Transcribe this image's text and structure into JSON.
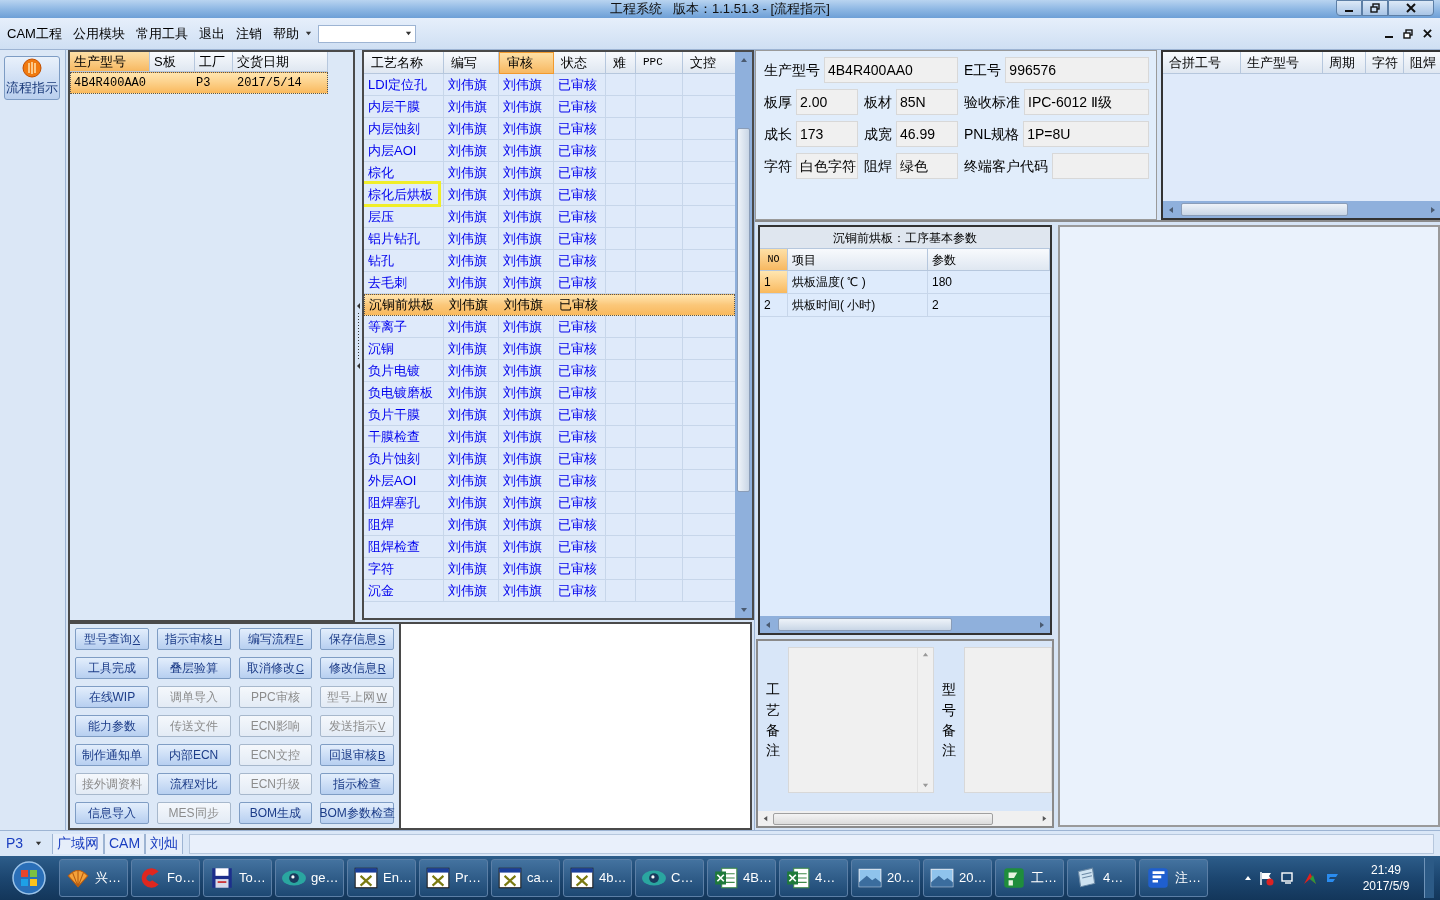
{
  "window": {
    "title": "工程系统   版本：1.1.51.3 - [流程指示]"
  },
  "menu": [
    "CAM工程",
    "公用模块",
    "常用工具",
    "退出",
    "注销",
    "帮助"
  ],
  "nav": [
    {
      "label": "流程指示",
      "selected": true
    }
  ],
  "orders": {
    "columns": [
      {
        "label": "生产型号",
        "selected": true
      },
      {
        "label": "S板",
        "selected": false
      },
      {
        "label": "工厂",
        "selected": false
      },
      {
        "label": "交货日期",
        "selected": false
      }
    ],
    "rows": [
      {
        "model": "4B4R400AA0",
        "factory": "P3",
        "date": "2017/5/14",
        "selected": true
      }
    ]
  },
  "process": {
    "columns": [
      {
        "label": "工艺名称",
        "selected": false
      },
      {
        "label": "编写",
        "selected": false
      },
      {
        "label": "审核",
        "selected": true
      },
      {
        "label": "状态",
        "selected": false
      },
      {
        "label": "难",
        "selected": false
      },
      {
        "label": "PPC",
        "selected": false
      },
      {
        "label": "文控",
        "selected": false
      }
    ],
    "rows": [
      {
        "name": "LDI定位孔",
        "writer": "刘伟旗",
        "reviewer": "刘伟旗",
        "status": "已审核",
        "selected": false,
        "outlined": false
      },
      {
        "name": "内层干膜",
        "writer": "刘伟旗",
        "reviewer": "刘伟旗",
        "status": "已审核",
        "selected": false,
        "outlined": false
      },
      {
        "name": "内层蚀刻",
        "writer": "刘伟旗",
        "reviewer": "刘伟旗",
        "status": "已审核",
        "selected": false,
        "outlined": false
      },
      {
        "name": "内层AOI",
        "writer": "刘伟旗",
        "reviewer": "刘伟旗",
        "status": "已审核",
        "selected": false,
        "outlined": false
      },
      {
        "name": "棕化",
        "writer": "刘伟旗",
        "reviewer": "刘伟旗",
        "status": "已审核",
        "selected": false,
        "outlined": false
      },
      {
        "name": "棕化后烘板",
        "writer": "刘伟旗",
        "reviewer": "刘伟旗",
        "status": "已审核",
        "selected": false,
        "outlined": true
      },
      {
        "name": "层压",
        "writer": "刘伟旗",
        "reviewer": "刘伟旗",
        "status": "已审核",
        "selected": false,
        "outlined": false
      },
      {
        "name": "铝片钻孔",
        "writer": "刘伟旗",
        "reviewer": "刘伟旗",
        "status": "已审核",
        "selected": false,
        "outlined": false
      },
      {
        "name": "钻孔",
        "writer": "刘伟旗",
        "reviewer": "刘伟旗",
        "status": "已审核",
        "selected": false,
        "outlined": false
      },
      {
        "name": "去毛刺",
        "writer": "刘伟旗",
        "reviewer": "刘伟旗",
        "status": "已审核",
        "selected": false,
        "outlined": false
      },
      {
        "name": "沉铜前烘板",
        "writer": "刘伟旗",
        "reviewer": "刘伟旗",
        "status": "已审核",
        "selected": true,
        "outlined": false
      },
      {
        "name": "等离子",
        "writer": "刘伟旗",
        "reviewer": "刘伟旗",
        "status": "已审核",
        "selected": false,
        "outlined": false
      },
      {
        "name": "沉铜",
        "writer": "刘伟旗",
        "reviewer": "刘伟旗",
        "status": "已审核",
        "selected": false,
        "outlined": false
      },
      {
        "name": "负片电镀",
        "writer": "刘伟旗",
        "reviewer": "刘伟旗",
        "status": "已审核",
        "selected": false,
        "outlined": false
      },
      {
        "name": "负电镀磨板",
        "writer": "刘伟旗",
        "reviewer": "刘伟旗",
        "status": "已审核",
        "selected": false,
        "outlined": false
      },
      {
        "name": "负片干膜",
        "writer": "刘伟旗",
        "reviewer": "刘伟旗",
        "status": "已审核",
        "selected": false,
        "outlined": false
      },
      {
        "name": "干膜检查",
        "writer": "刘伟旗",
        "reviewer": "刘伟旗",
        "status": "已审核",
        "selected": false,
        "outlined": false
      },
      {
        "name": "负片蚀刻",
        "writer": "刘伟旗",
        "reviewer": "刘伟旗",
        "status": "已审核",
        "selected": false,
        "outlined": false
      },
      {
        "name": "外层AOI",
        "writer": "刘伟旗",
        "reviewer": "刘伟旗",
        "status": "已审核",
        "selected": false,
        "outlined": false
      },
      {
        "name": "阻焊塞孔",
        "writer": "刘伟旗",
        "reviewer": "刘伟旗",
        "status": "已审核",
        "selected": false,
        "outlined": false
      },
      {
        "name": "阻焊",
        "writer": "刘伟旗",
        "reviewer": "刘伟旗",
        "status": "已审核",
        "selected": false,
        "outlined": false
      },
      {
        "name": "阻焊检查",
        "writer": "刘伟旗",
        "reviewer": "刘伟旗",
        "status": "已审核",
        "selected": false,
        "outlined": false
      },
      {
        "name": "字符",
        "writer": "刘伟旗",
        "reviewer": "刘伟旗",
        "status": "已审核",
        "selected": false,
        "outlined": false
      },
      {
        "name": "沉金",
        "writer": "刘伟旗",
        "reviewer": "刘伟旗",
        "status": "已审核",
        "selected": false,
        "outlined": false
      }
    ]
  },
  "actions": [
    {
      "label": "型号查询",
      "hotkey": "X",
      "disabled": false
    },
    {
      "label": "指示审核",
      "hotkey": "H",
      "disabled": false
    },
    {
      "label": "编写流程",
      "hotkey": "F",
      "disabled": false
    },
    {
      "label": "保存信息",
      "hotkey": "S",
      "disabled": false
    },
    {
      "label": "工具完成",
      "disabled": false
    },
    {
      "label": "叠层验算",
      "disabled": false
    },
    {
      "label": "取消修改",
      "hotkey": "C",
      "disabled": false
    },
    {
      "label": "修改信息",
      "hotkey": "R",
      "disabled": false
    },
    {
      "label": "在线WIP",
      "disabled": false
    },
    {
      "label": "调单导入",
      "disabled": true
    },
    {
      "label": "PPC审核",
      "disabled": true
    },
    {
      "label": "型号上网",
      "hotkey": "W",
      "disabled": true
    },
    {
      "label": "能力参数",
      "disabled": false
    },
    {
      "label": "传送文件",
      "disabled": true
    },
    {
      "label": "ECN影响",
      "disabled": true
    },
    {
      "label": "发送指示",
      "hotkey": "V",
      "disabled": true
    },
    {
      "label": "制作通知单",
      "disabled": false
    },
    {
      "label": "内部ECN",
      "disabled": false
    },
    {
      "label": "ECN文控",
      "disabled": true
    },
    {
      "label": "回退审核",
      "hotkey": "B",
      "disabled": false
    },
    {
      "label": "接外调资料",
      "disabled": true
    },
    {
      "label": "流程对比",
      "disabled": false
    },
    {
      "label": "ECN升级",
      "disabled": true
    },
    {
      "label": "指示检查",
      "disabled": false
    },
    {
      "label": "信息导入",
      "disabled": false
    },
    {
      "label": "MES同步",
      "disabled": true
    },
    {
      "label": "BOM生成",
      "disabled": false
    },
    {
      "label": "BOM参数检查",
      "disabled": false
    }
  ],
  "info": {
    "fields": [
      {
        "label": "生产型号",
        "value": "4B4R400AA0"
      },
      {
        "label": "E工号",
        "value": "996576"
      },
      {
        "label": "板厚",
        "value": "2.00"
      },
      {
        "label": "板材",
        "value": "85N"
      },
      {
        "label": "验收标准",
        "value": "IPC-6012 Ⅱ级"
      },
      {
        "label": "成长",
        "value": "173"
      },
      {
        "label": "成宽",
        "value": "46.99"
      },
      {
        "label": "PNL规格",
        "value": "1P=8U"
      },
      {
        "label": "字符",
        "value": "白色字符"
      },
      {
        "label": "阻焊",
        "value": "绿色"
      },
      {
        "label": "终端客户代码"
      }
    ]
  },
  "merge": {
    "columns": [
      "合拼工号",
      "生产型号",
      "周期",
      "字符",
      "阻焊"
    ]
  },
  "params": {
    "title": "沉铜前烘板：工序基本参数",
    "columns": [
      {
        "label": "NO",
        "selected": true
      },
      {
        "label": "项目",
        "selected": false
      },
      {
        "label": "参数",
        "selected": false
      }
    ],
    "rows": [
      {
        "no": "1",
        "item": "烘板温度( ℃ )",
        "value": "180",
        "selected": true
      },
      {
        "no": "2",
        "item": "烘板时间( 小时)",
        "value": "2",
        "selected": false
      }
    ]
  },
  "notes": [
    "工艺备注",
    "型号备注"
  ],
  "status_bar": {
    "selector": "P3",
    "items": [
      "广域网",
      "CAM",
      "刘灿"
    ]
  },
  "taskbar": {
    "items": [
      {
        "label": "兴…",
        "kind": "shell"
      },
      {
        "label": "Fo…",
        "kind": "swirl"
      },
      {
        "label": "To…",
        "kind": "floppy"
      },
      {
        "label": "ge…",
        "kind": "eye"
      },
      {
        "label": "En…",
        "kind": "window"
      },
      {
        "label": "Pr…",
        "kind": "window"
      },
      {
        "label": "ca…",
        "kind": "window"
      },
      {
        "label": "4b…",
        "kind": "window"
      },
      {
        "label": "C…",
        "kind": "eye"
      },
      {
        "label": "4B…",
        "kind": "sheet"
      },
      {
        "label": "4…",
        "kind": "sheet"
      },
      {
        "label": "20…",
        "kind": "photo"
      },
      {
        "label": "20…",
        "kind": "photo"
      },
      {
        "label": "工…",
        "kind": "plogo"
      },
      {
        "label": "4…",
        "kind": "notepad"
      },
      {
        "label": "注…",
        "kind": "flogo"
      }
    ],
    "clock": {
      "time": "21:49",
      "date": "2017/5/9"
    }
  }
}
